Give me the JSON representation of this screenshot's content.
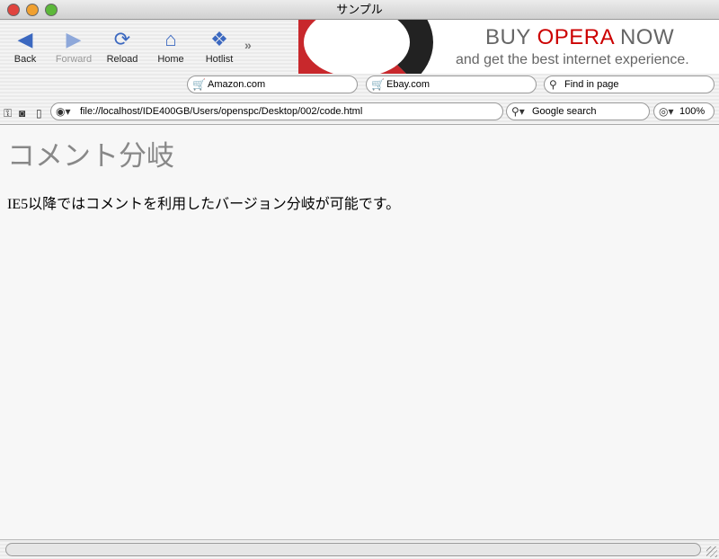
{
  "window": {
    "title": "サンプル"
  },
  "toolbar": {
    "back": "Back",
    "forward": "Forward",
    "reload": "Reload",
    "home": "Home",
    "hotlist": "Hotlist"
  },
  "banner": {
    "buy": "BUY ",
    "opera": "OPERA",
    "now": " NOW",
    "tagline": "and get the best internet experience."
  },
  "fields": {
    "amazon": "Amazon.com",
    "ebay": "Ebay.com",
    "find": "Find in page",
    "address": "file://localhost/IDE400GB/Users/openspc/Desktop/002/code.html",
    "search": "Google search",
    "zoom": "100%"
  },
  "page": {
    "heading": "コメント分岐",
    "body": "IE5以降ではコメントを利用したバージョン分岐が可能です。"
  }
}
